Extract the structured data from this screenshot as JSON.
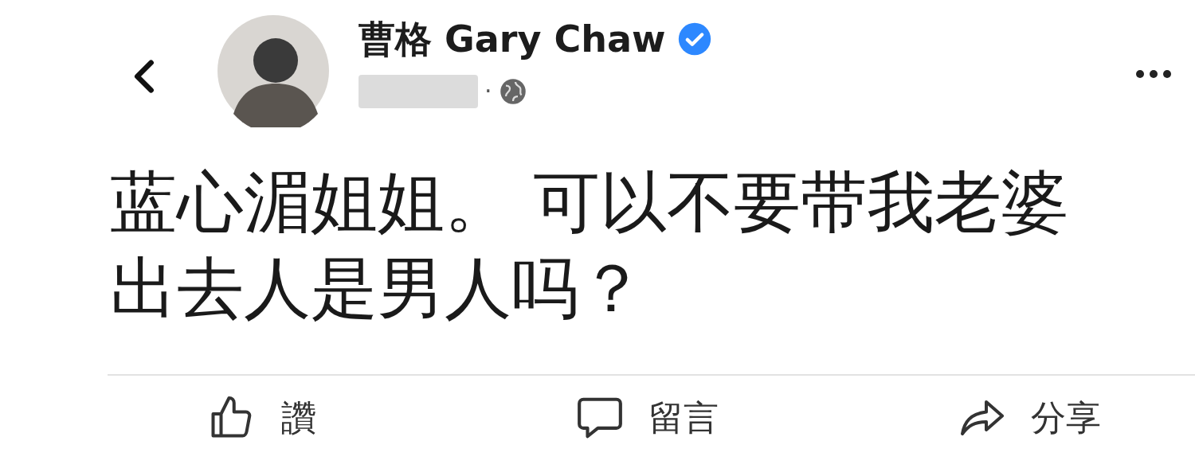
{
  "header": {
    "name": "曹格 Gary Chaw",
    "verified": true,
    "separator": "·"
  },
  "post": {
    "text": "蓝心湄姐姐。 可以不要带我老婆出去人是男人吗？"
  },
  "actions": [
    {
      "kind": "like",
      "label": "讚"
    },
    {
      "kind": "comment",
      "label": "留言"
    },
    {
      "kind": "share",
      "label": "分享"
    }
  ]
}
